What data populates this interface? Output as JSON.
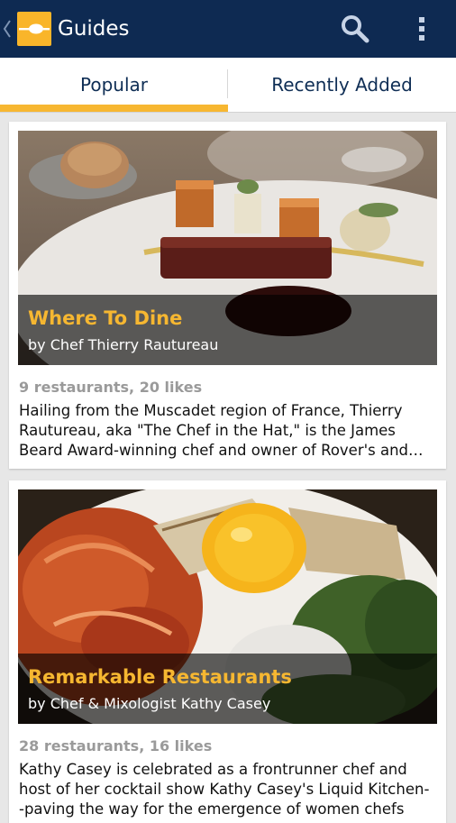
{
  "action_bar": {
    "title": "Guides",
    "colors": {
      "background": "#0e2a52",
      "logo": "#f9b52a"
    },
    "icons": [
      "back-chevron-icon",
      "app-logo-icon",
      "search-icon",
      "overflow-menu-icon"
    ]
  },
  "tabs": [
    {
      "label": "Popular",
      "selected": true
    },
    {
      "label": "Recently Added",
      "selected": false
    }
  ],
  "accent_color": "#f7b731",
  "guides": [
    {
      "title": "Where To Dine",
      "author": "by Chef Thierry Rautureau",
      "stats": "9 restaurants, 20 likes",
      "description": "Hailing from the Muscadet region of France, Thierry Rautureau, aka \"The Chef in the Hat,\" is the James Beard Award-winning chef and owner of Rover's and…"
    },
    {
      "title": "Remarkable Restaurants",
      "author": "by Chef & Mixologist Kathy Casey",
      "stats": "28 restaurants, 16 likes",
      "description": "Kathy Casey is celebrated as a frontrunner chef and host of her cocktail show Kathy Casey's Liquid Kitchen--paving the way for the emergence of women chefs on…"
    }
  ]
}
